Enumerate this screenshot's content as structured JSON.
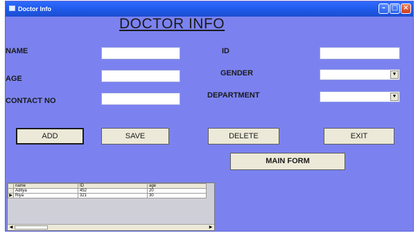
{
  "window": {
    "title": "Doctor Info"
  },
  "heading": "DOCTOR INFO",
  "fields": {
    "name_label": "NAME",
    "id_label": "ID",
    "age_label": "AGE",
    "gender_label": "GENDER",
    "contact_label": "CONTACT NO",
    "department_label": "DEPARTMENT",
    "name_value": "",
    "id_value": "",
    "age_value": "",
    "contact_value": "",
    "gender_value": "",
    "department_value": ""
  },
  "buttons": {
    "add": "ADD",
    "save": "SAVE",
    "delete": "DELETE",
    "exit": "EXIT",
    "main_form": "MAIN FORM"
  },
  "grid": {
    "columns": [
      "name",
      "ID",
      "age"
    ],
    "rows": [
      {
        "marker": "",
        "cells": [
          "Aditya",
          "452",
          "20"
        ]
      },
      {
        "marker": "▶",
        "cells": [
          "Riya",
          "321",
          "30"
        ]
      }
    ]
  },
  "icons": {
    "window_icon": "window-icon",
    "minimize": "minimize-icon",
    "maximize": "maximize-icon",
    "close": "close-icon",
    "dropdown": "chevron-down-icon"
  },
  "colors": {
    "form_background": "#7b82ef",
    "titlebar": "#1e59e8",
    "button_face": "#ece9d8"
  }
}
